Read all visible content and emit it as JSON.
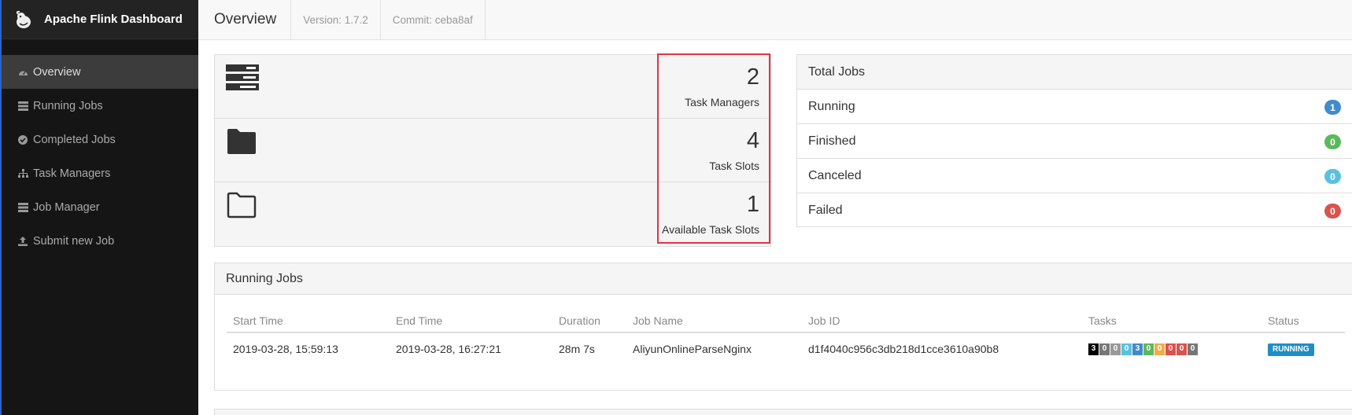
{
  "app": {
    "title": "Apache Flink Dashboard"
  },
  "colors": {
    "accent": "#2a62c9",
    "highlight": "#dc3545",
    "running": "#428bca",
    "finished": "#5cb85c",
    "canceled": "#5bc0de",
    "failed": "#d9534f",
    "status_running": "#1e8fc6"
  },
  "sidebar": {
    "items": [
      {
        "label": "Overview",
        "icon": "dashboard-icon",
        "active": true
      },
      {
        "label": "Running Jobs",
        "icon": "tasks-icon",
        "active": false
      },
      {
        "label": "Completed Jobs",
        "icon": "check-circle-icon",
        "active": false
      },
      {
        "label": "Task Managers",
        "icon": "sitemap-icon",
        "active": false
      },
      {
        "label": "Job Manager",
        "icon": "server-icon",
        "active": false
      },
      {
        "label": "Submit new Job",
        "icon": "upload-icon",
        "active": false
      }
    ]
  },
  "header": {
    "title": "Overview",
    "version": "Version: 1.7.2",
    "commit": "Commit: ceba8af"
  },
  "stats": [
    {
      "value": "2",
      "label": "Task Managers",
      "icon": "server-stack-icon"
    },
    {
      "value": "4",
      "label": "Task Slots",
      "icon": "folder-icon"
    },
    {
      "value": "1",
      "label": "Available Task Slots",
      "icon": "folder-open-icon"
    }
  ],
  "totals": {
    "title": "Total Jobs",
    "rows": [
      {
        "label": "Running",
        "count": "1",
        "color": "#428bca"
      },
      {
        "label": "Finished",
        "count": "0",
        "color": "#5cb85c"
      },
      {
        "label": "Canceled",
        "count": "0",
        "color": "#5bc0de"
      },
      {
        "label": "Failed",
        "count": "0",
        "color": "#d9534f"
      }
    ]
  },
  "running_jobs": {
    "title": "Running Jobs",
    "columns": [
      "Start Time",
      "End Time",
      "Duration",
      "Job Name",
      "Job ID",
      "Tasks",
      "Status"
    ],
    "rows": [
      {
        "start": "2019-03-28, 15:59:13",
        "end": "2019-03-28, 16:27:21",
        "duration": "28m 7s",
        "name": "AliyunOnlineParseNginx",
        "id": "d1f4040c956c3db218d1cce3610a90b8",
        "tasks": [
          {
            "v": "3",
            "c": "#000000"
          },
          {
            "v": "0",
            "c": "#777777"
          },
          {
            "v": "0",
            "c": "#999999"
          },
          {
            "v": "0",
            "c": "#5bc0de"
          },
          {
            "v": "3",
            "c": "#428bca"
          },
          {
            "v": "0",
            "c": "#5cb85c"
          },
          {
            "v": "0",
            "c": "#f0ad4e"
          },
          {
            "v": "0",
            "c": "#d9534f"
          },
          {
            "v": "0",
            "c": "#d9534f"
          },
          {
            "v": "0",
            "c": "#777777"
          }
        ],
        "status": "RUNNING"
      }
    ]
  }
}
